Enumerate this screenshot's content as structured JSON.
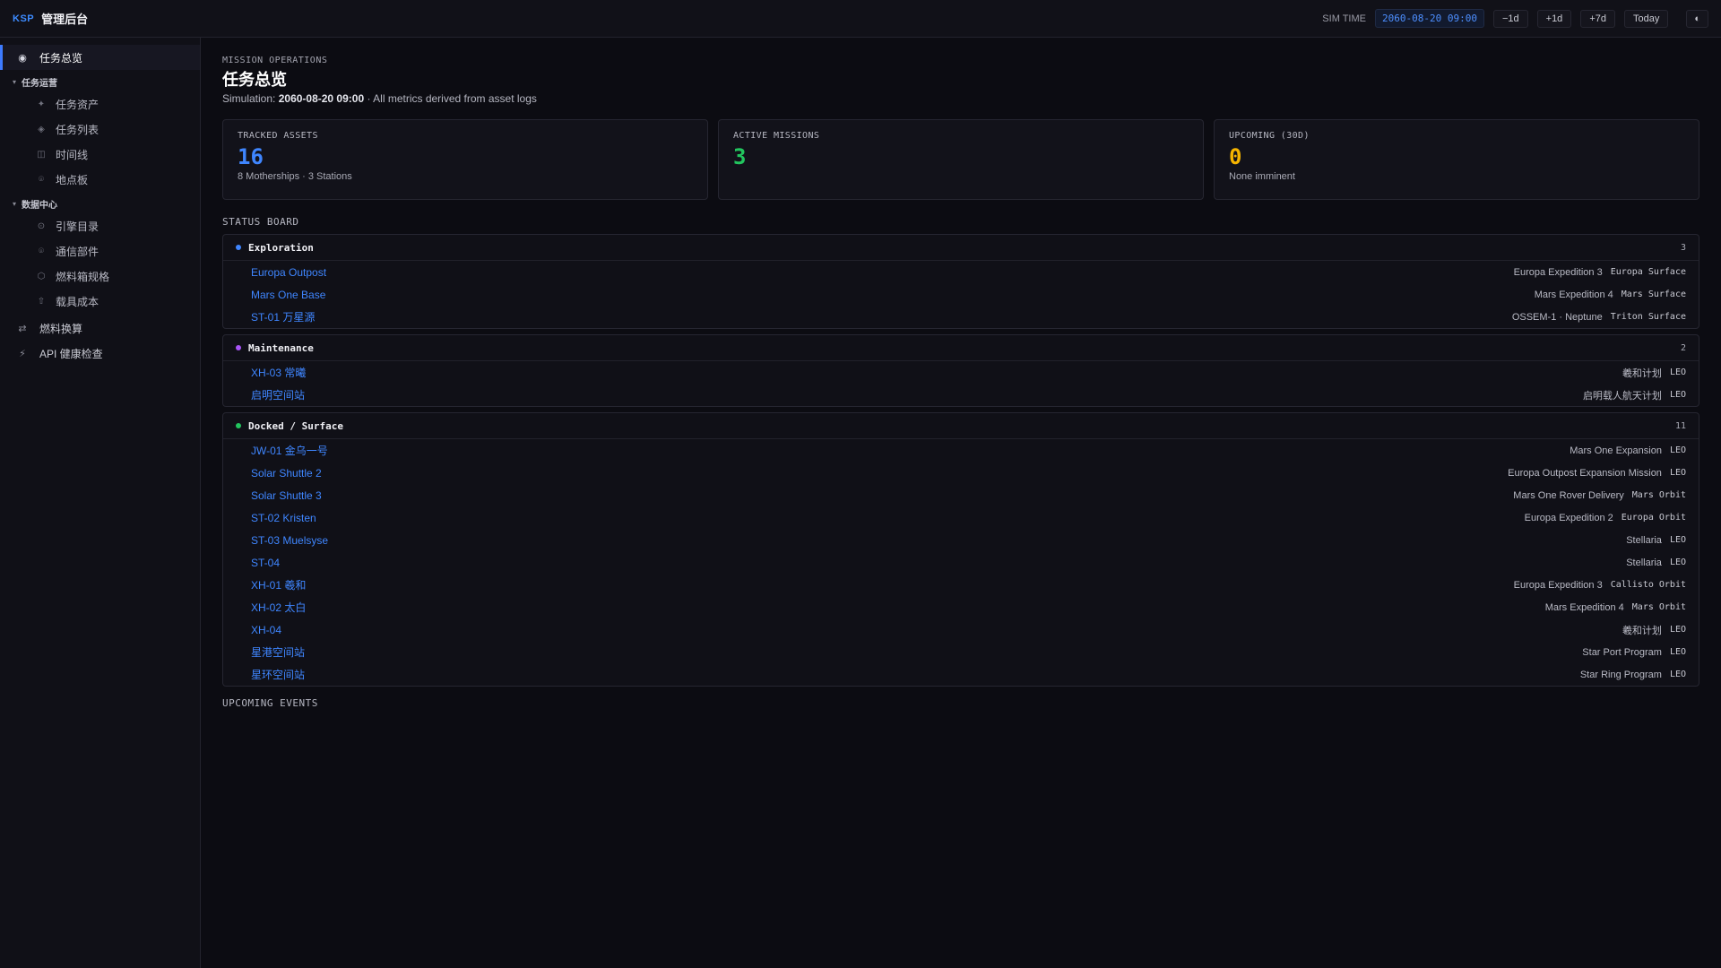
{
  "header": {
    "brand_tag": "KSP",
    "app_title": "管理后台",
    "sim_label": "SIM TIME",
    "sim_time": "2060-08-20 09:00",
    "buttons": {
      "minus_1d": "−1d",
      "plus_1d": "+1d",
      "plus_7d": "+7d",
      "today": "Today",
      "theme": "◐"
    }
  },
  "sidebar": {
    "overview": {
      "label": "任务总览",
      "icon": "◉"
    },
    "group1": {
      "label": "任务运营",
      "items": [
        {
          "label": "任务资产",
          "icon": "✦"
        },
        {
          "label": "任务列表",
          "icon": "◈"
        },
        {
          "label": "时间线",
          "icon": "◫"
        },
        {
          "label": "地点板",
          "icon": "⌾"
        }
      ]
    },
    "group2": {
      "label": "数据中心",
      "items": [
        {
          "label": "引擎目录",
          "icon": "⊙"
        },
        {
          "label": "通信部件",
          "icon": "⌾"
        },
        {
          "label": "燃料箱规格",
          "icon": "⬡"
        },
        {
          "label": "载具成本",
          "icon": "⇧"
        }
      ]
    },
    "fuel_convert": {
      "label": "燃料换算",
      "icon": "⇄"
    },
    "api_health": {
      "label": "API 健康检查",
      "icon": "⚡"
    }
  },
  "main": {
    "eyebrow": "MISSION OPERATIONS",
    "title": "任务总览",
    "subtitle_prefix": "Simulation:",
    "subtitle_time": "2060-08-20 09:00",
    "subtitle_suffix": "· All metrics derived from asset logs",
    "cards": {
      "tracked": {
        "label": "TRACKED ASSETS",
        "value": "16",
        "note": "8 Motherships · 3 Stations"
      },
      "active": {
        "label": "ACTIVE MISSIONS",
        "value": "3",
        "note": ""
      },
      "upcoming": {
        "label": "UPCOMING (30D)",
        "value": "0",
        "note": "None imminent"
      }
    },
    "status_board_label": "STATUS BOARD",
    "upcoming_events_label": "UPCOMING EVENTS",
    "groups": {
      "exploration": {
        "name": "Exploration",
        "count": "3",
        "color": "#3f86ff",
        "rows": [
          {
            "name": "Europa Outpost",
            "mission": "Europa Expedition 3",
            "loc": "Europa Surface"
          },
          {
            "name": "Mars One Base",
            "mission": "Mars Expedition 4",
            "loc": "Mars Surface"
          },
          {
            "name": "ST-01 万星源",
            "mission": "OSSEM-1 · Neptune",
            "loc": "Triton Surface"
          }
        ]
      },
      "maintenance": {
        "name": "Maintenance",
        "count": "2",
        "color": "#a855f7",
        "rows": [
          {
            "name": "XH-03 常曦",
            "mission": "羲和计划",
            "loc": "LEO"
          },
          {
            "name": "启明空间站",
            "mission": "启明载人航天计划",
            "loc": "LEO"
          }
        ]
      },
      "docked": {
        "name": "Docked / Surface",
        "count": "11",
        "color": "#22c55e",
        "rows": [
          {
            "name": "JW-01 金乌一号",
            "mission": "Mars One Expansion",
            "loc": "LEO"
          },
          {
            "name": "Solar Shuttle 2",
            "mission": "Europa Outpost Expansion Mission",
            "loc": "LEO"
          },
          {
            "name": "Solar Shuttle 3",
            "mission": "Mars One Rover Delivery",
            "loc": "Mars Orbit"
          },
          {
            "name": "ST-02 Kristen",
            "mission": "Europa Expedition 2",
            "loc": "Europa Orbit"
          },
          {
            "name": "ST-03 Muelsyse",
            "mission": "Stellaria",
            "loc": "LEO"
          },
          {
            "name": "ST-04",
            "mission": "Stellaria",
            "loc": "LEO"
          },
          {
            "name": "XH-01 羲和",
            "mission": "Europa Expedition 3",
            "loc": "Callisto Orbit"
          },
          {
            "name": "XH-02 太白",
            "mission": "Mars Expedition 4",
            "loc": "Mars Orbit"
          },
          {
            "name": "XH-04",
            "mission": "羲和计划",
            "loc": "LEO"
          },
          {
            "name": "星港空间站",
            "mission": "Star Port Program",
            "loc": "LEO"
          },
          {
            "name": "星环空间站",
            "mission": "Star Ring Program",
            "loc": "LEO"
          }
        ]
      }
    }
  }
}
